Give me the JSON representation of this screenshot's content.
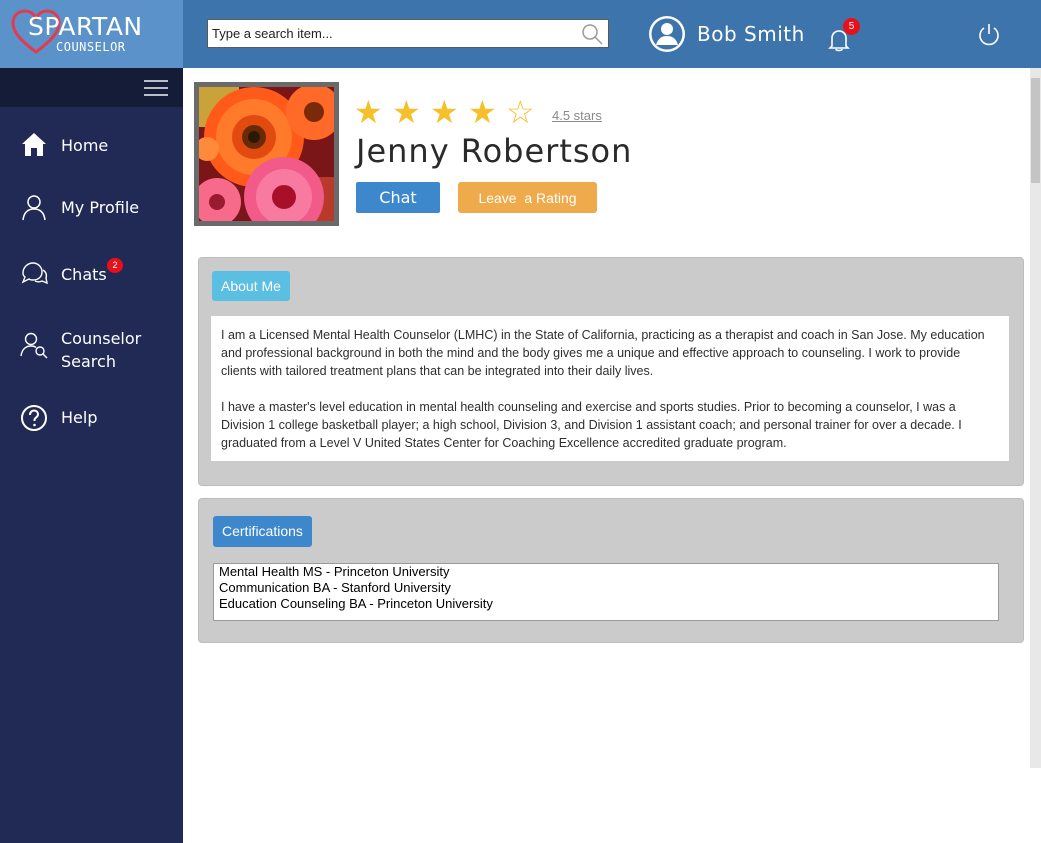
{
  "app": {
    "logo_title": "SPARTAN",
    "logo_subtitle": "COUNSELOR",
    "logo_icon": "heart-icon"
  },
  "header": {
    "search_placeholder": "Type a search item...",
    "search_icon": "search-icon",
    "user_name": "Bob Smith",
    "notification_count": "5",
    "power_icon": "power-icon"
  },
  "sidebar": {
    "menu_icon": "hamburger-icon",
    "items": [
      {
        "label": "Home",
        "icon": "home-icon"
      },
      {
        "label": "My Profile",
        "icon": "user-icon"
      },
      {
        "label": "Chats",
        "icon": "chat-bubbles-icon",
        "badge": "2"
      },
      {
        "label": "Counselor",
        "label2": "Search",
        "icon": "user-search-icon"
      },
      {
        "label": "Help",
        "icon": "help-icon"
      }
    ]
  },
  "profile": {
    "name": "Jenny Robertson",
    "rating": 4.5,
    "rating_text": "4.5 stars",
    "chat_button": "Chat",
    "rate_button": "Leave  a Rating"
  },
  "about": {
    "tab_label": "About Me",
    "paragraphs": [
      "I am a Licensed Mental Health Counselor (LMHC) in the State of California, practicing as a therapist and coach in San Jose. My education and professional background in both the mind and the body gives me a unique and effective approach to counseling. I work to provide clients with tailored treatment plans that can be integrated into their daily lives.",
      "I have a master's level education in mental health counseling and exercise and sports studies. Prior to becoming a counselor, I was a Division 1 college basketball player; a high school, Division 3, and Division 1 assistant coach; and personal trainer for over a decade. I graduated from a Level V United States Center for Coaching Excellence accredited graduate program."
    ]
  },
  "certifications": {
    "tab_label": "Certifications",
    "items": [
      "Mental Health MS - Princeton University",
      "Communication BA - Stanford University",
      "Education Counseling BA - Princeton University"
    ]
  },
  "colors": {
    "header": "#3d74ac",
    "sidebar": "#202a55",
    "star": "#f6c02b",
    "chat_button": "#3d87cc",
    "rate_button": "#eeaa4b",
    "badge": "#e8111a"
  }
}
